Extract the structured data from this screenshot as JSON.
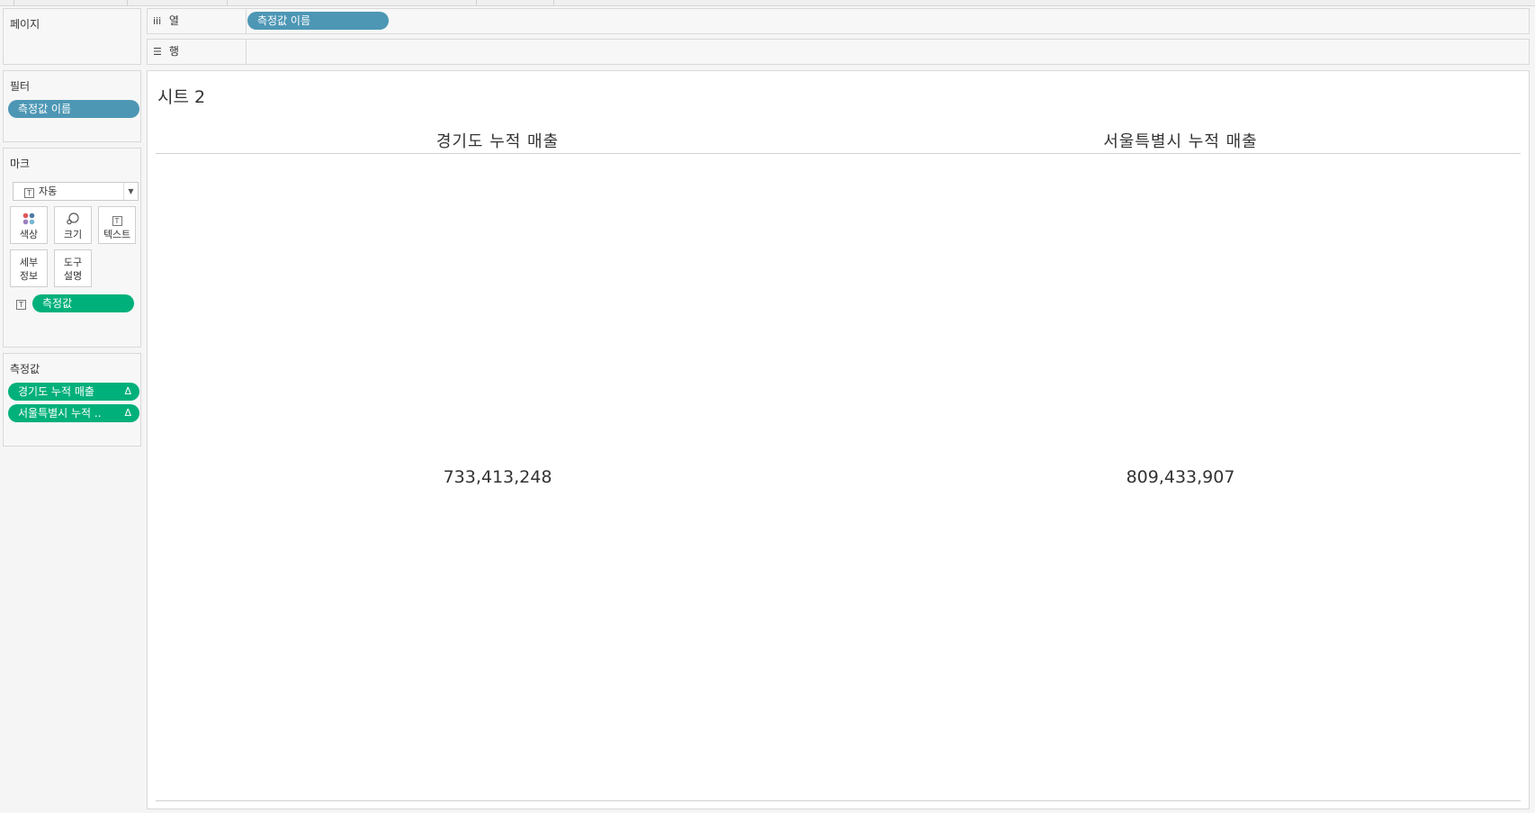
{
  "pages": {
    "title": "페이지"
  },
  "filters": {
    "title": "필터",
    "pill": "측정값 이름"
  },
  "marks": {
    "title": "마크",
    "type_value": "자동",
    "buttons": {
      "color": "색상",
      "size": "크기",
      "text": "텍스트",
      "detail_line1": "세부",
      "detail_line2": "정보",
      "tooltip_line1": "도구",
      "tooltip_line2": "설명"
    },
    "text_field": "측정값"
  },
  "measure_values": {
    "title": "측정값",
    "items": [
      {
        "label": "경기도 누적 매출",
        "delta": "Δ"
      },
      {
        "label": "서울특별시 누적 ..",
        "delta": "Δ"
      }
    ]
  },
  "columns_shelf": {
    "label": "열",
    "pill": "측정값 이름"
  },
  "rows_shelf": {
    "label": "행"
  },
  "sheet": {
    "title": "시트 2",
    "headers": [
      "경기도 누적 매출",
      "서울특별시 누적 매출"
    ],
    "values": [
      "733,413,248",
      "809,433,907"
    ]
  },
  "chart_data": {
    "type": "table",
    "categories": [
      "경기도 누적 매출",
      "서울특별시 누적 매출"
    ],
    "values": [
      733413248,
      809433907
    ],
    "title": "시트 2"
  },
  "colors": {
    "dimension_pill": "#4d97b5",
    "measure_pill": "#00b07a"
  },
  "icons": {
    "columns": "columns-icon",
    "rows": "rows-icon",
    "text_mark": "text-mark-icon",
    "color": "color-dots-icon",
    "size": "size-icon",
    "delta": "delta-icon",
    "dropdown": "chevron-down-icon"
  }
}
